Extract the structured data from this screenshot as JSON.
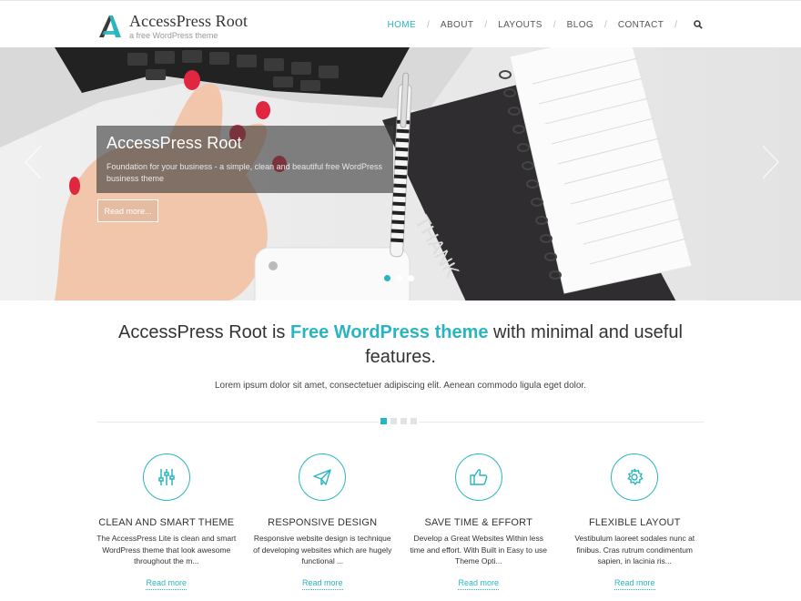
{
  "brand": {
    "title": "AccessPress Root",
    "tagline": "a free WordPress theme",
    "accent": "#29b5c0",
    "logo_dark": "#3a3a3a"
  },
  "nav": {
    "items": [
      {
        "label": "HOME",
        "active": true
      },
      {
        "label": "ABOUT"
      },
      {
        "label": "LAYOUTS"
      },
      {
        "label": "BLOG"
      },
      {
        "label": "CONTACT"
      }
    ],
    "separator": "/",
    "search_icon": "search-icon"
  },
  "hero": {
    "caption_title": "AccessPress Root",
    "caption_text": "Foundation for your business - a simple, clean and beautiful free WordPress business theme",
    "button_label": "Read more...",
    "active_slide": 1,
    "slide_count": 3
  },
  "intro": {
    "heading_before": "AccessPress Root is ",
    "heading_highlight": "Free WordPress theme",
    "heading_after": " with minimal and useful features.",
    "text": "Lorem ipsum dolor sit amet, consectetuer adipiscing elit. Aenean commodo ligula eget dolor."
  },
  "features": [
    {
      "icon": "sliders-icon",
      "title": "CLEAN AND SMART THEME",
      "text": "The AccessPress Lite is clean and smart WordPress theme that look awesome throughout the m...",
      "more": "Read more"
    },
    {
      "icon": "paper-plane-icon",
      "title": "RESPONSIVE DESIGN",
      "text": "Responsive website design is technique of developing websites which are hugely functional ...",
      "more": "Read more"
    },
    {
      "icon": "thumbs-up-icon",
      "title": "SAVE TIME & EFFORT",
      "text": "Develop a Great Websites Within less time and effort. With Built in Easy to use Theme Opti...",
      "more": "Read more"
    },
    {
      "icon": "gear-icon",
      "title": "FLEXIBLE LAYOUT",
      "text": "Vestibulum laoreet sodales nunc at finibus. Cras rutrum condimentum sapien, in lacinia ris...",
      "more": "Read more"
    }
  ]
}
